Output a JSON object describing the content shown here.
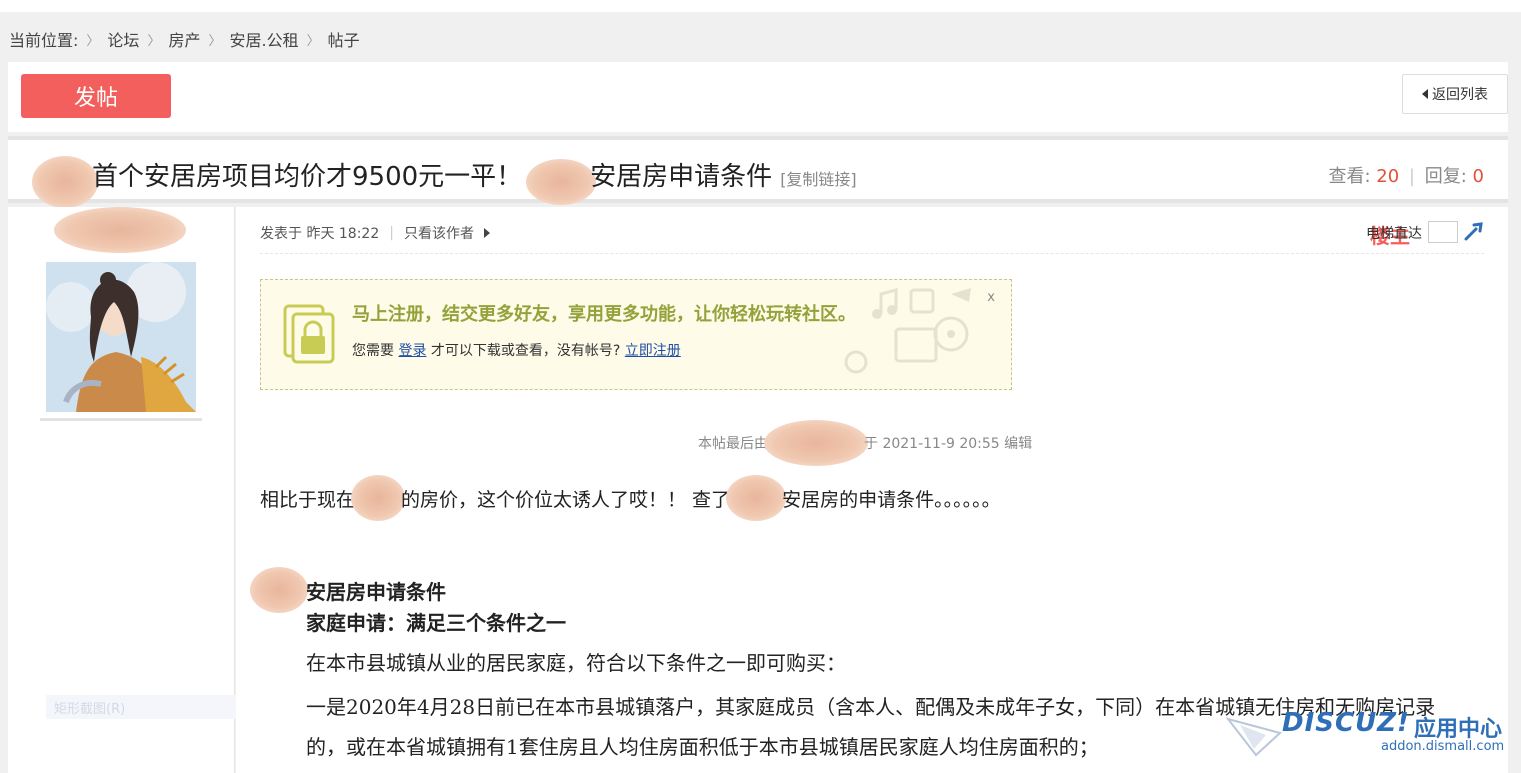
{
  "breadcrumb": {
    "label": "当前位置:",
    "items": [
      "论坛",
      "房产",
      "安居.公租",
      "帖子"
    ]
  },
  "toolbar": {
    "post_button": "发帖",
    "back_button": "返回列表"
  },
  "thread": {
    "title_part1": "首个安居房项目均价才9500元一平！",
    "title_part2": "安居房申请条件",
    "copy_link": "[复制链接]",
    "views_label": "查看:",
    "views": "20",
    "replies_label": "回复:",
    "replies": "0"
  },
  "post": {
    "posted_at": "发表于 昨天 18:22",
    "only_author": "只看该作者",
    "floor": "楼主",
    "jump_label": "电梯直达",
    "edit_prefix": "本帖最后由",
    "edit_suffix": "于 2021-11-9 20:55 编辑"
  },
  "notice": {
    "headline": "马上注册，结交更多好友，享用更多功能，让你轻松玩转社区。",
    "text1": "您需要",
    "login": "登录",
    "text2": "才可以下载或查看，没有帐号?",
    "register": "立即注册",
    "close": "x"
  },
  "content": {
    "p1_a": "相比于现在",
    "p1_b": "的房价，这个价位太诱人了哎！！ 查了",
    "p1_c": "安居房的申请条件。。。。。。",
    "heading": "安居房申请条件",
    "sub": "家庭申请：满足三个条件之一",
    "line1": "在本市县城镇从业的居民家庭，符合以下条件之一即可购买：",
    "line2": "一是2020年4月28日前已在本市县城镇落户，其家庭成员（含本人、配偶及未成年子女，下同）在本省城镇无住房和无购房记录的，或在本省城镇拥有1套住房且人均住房面积低于本市县城镇居民家庭人均住房面积的；"
  },
  "left": {
    "faded_text": "矩形截图(R)"
  },
  "watermark": {
    "brand": "DISCUZ!",
    "cn": "应用中心",
    "url": "addon.dismall.com"
  }
}
